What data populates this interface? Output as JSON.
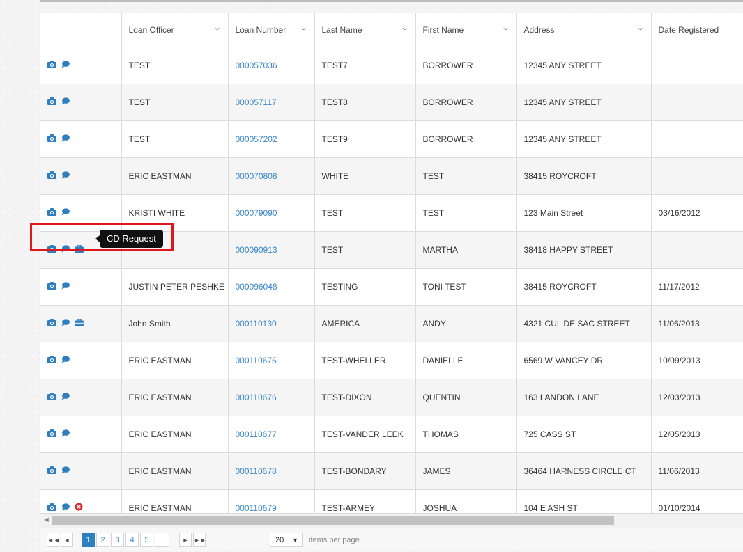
{
  "columns": [
    {
      "label": "",
      "chevron": false
    },
    {
      "label": "Loan Officer",
      "chevron": true
    },
    {
      "label": "Loan Number",
      "chevron": true
    },
    {
      "label": "Last Name",
      "chevron": true
    },
    {
      "label": "First Name",
      "chevron": true
    },
    {
      "label": "Address",
      "chevron": true
    },
    {
      "label": "Date Registered",
      "chevron": false
    }
  ],
  "rows": [
    {
      "icons": [
        "camera-icon",
        "comment-icon"
      ],
      "loan_officer": "TEST",
      "loan_number": "000057036",
      "last_name": "TEST7",
      "first_name": "BORROWER",
      "address": "12345 ANY STREET",
      "date_registered": ""
    },
    {
      "icons": [
        "camera-icon",
        "comment-icon"
      ],
      "loan_officer": "TEST",
      "loan_number": "000057117",
      "last_name": "TEST8",
      "first_name": "BORROWER",
      "address": "12345 ANY STREET",
      "date_registered": ""
    },
    {
      "icons": [
        "camera-icon",
        "comment-icon"
      ],
      "loan_officer": "TEST",
      "loan_number": "000057202",
      "last_name": "TEST9",
      "first_name": "BORROWER",
      "address": "12345 ANY STREET",
      "date_registered": ""
    },
    {
      "icons": [
        "camera-icon",
        "comment-icon"
      ],
      "loan_officer": "ERIC EASTMAN",
      "loan_number": "000070808",
      "last_name": "WHITE",
      "first_name": "TEST",
      "address": "38415 ROYCROFT",
      "date_registered": ""
    },
    {
      "icons": [
        "camera-icon",
        "comment-icon"
      ],
      "loan_officer": "KRISTI WHITE",
      "loan_number": "000079090",
      "last_name": "TEST",
      "first_name": "TEST",
      "address": "123 Main Street",
      "date_registered": "03/16/2012"
    },
    {
      "icons": [
        "camera-icon",
        "comment-icon",
        "briefcase-icon"
      ],
      "loan_officer": "",
      "loan_number": "000090913",
      "last_name": "TEST",
      "first_name": "MARTHA",
      "address": "38418 HAPPY STREET",
      "date_registered": ""
    },
    {
      "icons": [
        "camera-icon",
        "comment-icon"
      ],
      "loan_officer": "JUSTIN PETER PESHKE",
      "loan_number": "000096048",
      "last_name": "TESTING",
      "first_name": "TONI TEST",
      "address": "38415 ROYCROFT",
      "date_registered": "11/17/2012"
    },
    {
      "icons": [
        "camera-icon",
        "comment-icon",
        "briefcase-icon"
      ],
      "loan_officer": "John Smith",
      "loan_number": "000110130",
      "last_name": "AMERICA",
      "first_name": "ANDY",
      "address": "4321 CUL DE SAC STREET",
      "date_registered": "11/06/2013"
    },
    {
      "icons": [
        "camera-icon",
        "comment-icon"
      ],
      "loan_officer": "ERIC EASTMAN",
      "loan_number": "000110675",
      "last_name": "TEST-WHELLER",
      "first_name": "DANIELLE",
      "address": "6569 W VANCEY DR",
      "date_registered": "10/09/2013"
    },
    {
      "icons": [
        "camera-icon",
        "comment-icon"
      ],
      "loan_officer": "ERIC EASTMAN",
      "loan_number": "000110676",
      "last_name": "TEST-DIXON",
      "first_name": "QUENTIN",
      "address": "163 LANDON LANE",
      "date_registered": "12/03/2013"
    },
    {
      "icons": [
        "camera-icon",
        "comment-icon"
      ],
      "loan_officer": "ERIC EASTMAN",
      "loan_number": "000110677",
      "last_name": "TEST-VANDER LEEK",
      "first_name": "THOMAS",
      "address": "725 CASS ST",
      "date_registered": "12/05/2013"
    },
    {
      "icons": [
        "camera-icon",
        "comment-icon"
      ],
      "loan_officer": "ERIC EASTMAN",
      "loan_number": "000110678",
      "last_name": "TEST-BONDARY",
      "first_name": "JAMES",
      "address": "36464 HARNESS CIRCLE CT",
      "date_registered": "11/06/2013"
    },
    {
      "icons": [
        "camera-icon",
        "comment-icon",
        "cancel-circle-icon"
      ],
      "loan_officer": "ERIC EASTMAN",
      "loan_number": "000110679",
      "last_name": "TEST-ARMEY",
      "first_name": "JOSHUA",
      "address": "104 E ASH ST",
      "date_registered": "01/10/2014"
    },
    {
      "icons": [],
      "loan_officer": "",
      "loan_number": "",
      "last_name": "",
      "first_name": "",
      "address": "",
      "date_registered": ""
    }
  ],
  "tooltip": {
    "text": "CD Request"
  },
  "pager": {
    "first_label": "◄◄",
    "prev_label": "◄",
    "pages": [
      "1",
      "2",
      "3",
      "4",
      "5"
    ],
    "ellipsis": "...",
    "next_label": "►",
    "last_label": "►►",
    "page_size": "20",
    "items_per_page_label": "items per page"
  },
  "colors": {
    "icon_blue": "#2f7ec0",
    "link_blue": "#3a86c8",
    "highlight_red": "#e0161d",
    "cancel_red": "#d9292f"
  }
}
